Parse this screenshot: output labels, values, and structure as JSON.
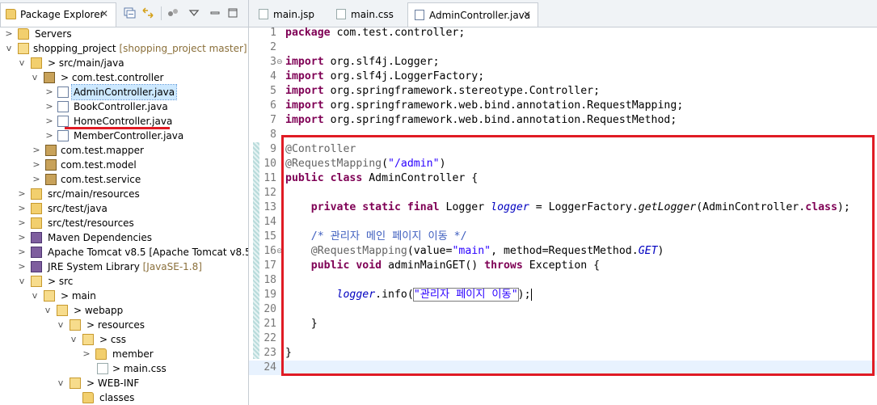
{
  "package_explorer": {
    "tab_label": "Package Explorer",
    "close_glyph": "✕",
    "toolbar_icons": [
      "collapse-all-icon",
      "link-with-editor-icon",
      "filter-icon",
      "view-menu-icon",
      "minimize-icon",
      "maximize-icon"
    ],
    "tree": [
      {
        "label": "Servers",
        "twisty": ">",
        "icon": "folder-icon"
      },
      {
        "label": "shopping_project",
        "suffix": " [shopping_project master]",
        "twisty": "v",
        "icon": "project-icon"
      },
      {
        "label": "> src/main/java",
        "twisty": "v",
        "icon": "source-folder-icon"
      },
      {
        "label": "> com.test.controller",
        "twisty": "v",
        "icon": "package-icon"
      },
      {
        "label": "AdminController.java",
        "twisty": ">",
        "icon": "java-file-icon"
      },
      {
        "label": "BookController.java",
        "twisty": ">",
        "icon": "java-file-icon"
      },
      {
        "label": "HomeController.java",
        "twisty": ">",
        "icon": "java-file-icon"
      },
      {
        "label": "MemberController.java",
        "twisty": ">",
        "icon": "java-file-icon"
      },
      {
        "label": "com.test.mapper",
        "twisty": ">",
        "icon": "package-icon"
      },
      {
        "label": "com.test.model",
        "twisty": ">",
        "icon": "package-icon"
      },
      {
        "label": "com.test.service",
        "twisty": ">",
        "icon": "package-icon"
      },
      {
        "label": "src/main/resources",
        "twisty": ">",
        "icon": "source-folder-icon"
      },
      {
        "label": "src/test/java",
        "twisty": ">",
        "icon": "source-folder-icon"
      },
      {
        "label": "src/test/resources",
        "twisty": ">",
        "icon": "source-folder-icon"
      },
      {
        "label": "Maven Dependencies",
        "twisty": ">",
        "icon": "library-icon"
      },
      {
        "label": "Apache Tomcat v8.5 [Apache Tomcat v8.5]",
        "twisty": ">",
        "icon": "library-icon"
      },
      {
        "label": "JRE System Library",
        "suffix": " [JavaSE-1.8]",
        "twisty": ">",
        "icon": "library-icon"
      },
      {
        "label": "> src",
        "twisty": "v",
        "icon": "folder-icon"
      },
      {
        "label": "> main",
        "twisty": "v",
        "icon": "folder-icon"
      },
      {
        "label": "> webapp",
        "twisty": "v",
        "icon": "folder-icon"
      },
      {
        "label": "> resources",
        "twisty": "v",
        "icon": "folder-icon"
      },
      {
        "label": "> css",
        "twisty": "v",
        "icon": "folder-icon"
      },
      {
        "label": "member",
        "twisty": ">",
        "icon": "folder-icon"
      },
      {
        "label": "> main.css",
        "twisty": "",
        "icon": "css-file-icon"
      },
      {
        "label": "> WEB-INF",
        "twisty": "v",
        "icon": "folder-icon"
      },
      {
        "label": "classes",
        "twisty": "",
        "icon": "folder-icon"
      }
    ]
  },
  "editor": {
    "tabs": [
      {
        "label": "main.jsp",
        "active": false
      },
      {
        "label": "main.css",
        "active": false
      },
      {
        "label": "AdminController.java",
        "active": true
      }
    ],
    "close_glyph": "✕",
    "line_numbers": [
      "1",
      "2",
      "3",
      "4",
      "5",
      "6",
      "7",
      "8",
      "9",
      "10",
      "11",
      "12",
      "13",
      "14",
      "15",
      "16",
      "17",
      "18",
      "19",
      "20",
      "21",
      "22",
      "23",
      "24"
    ],
    "code": {
      "l1": {
        "kw": "package",
        "rest": " com.test.controller;"
      },
      "l3": {
        "kw": "import",
        "rest": " org.slf4j.Logger;"
      },
      "l4": {
        "kw": "import",
        "rest": " org.slf4j.LoggerFactory;"
      },
      "l5": {
        "kw": "import",
        "rest": " org.springframework.stereotype.Controller;"
      },
      "l6": {
        "kw": "import",
        "rest": " org.springframework.web.bind.annotation.RequestMapping;"
      },
      "l7": {
        "kw": "import",
        "rest": " org.springframework.web.bind.annotation.RequestMethod;"
      },
      "l9": {
        "an": "@Controller"
      },
      "l10": {
        "an": "@RequestMapping",
        "p1": "(",
        "str": "\"/admin\"",
        "p2": ")"
      },
      "l11": {
        "kw1": "public",
        "kw2": "class",
        "rest": " AdminController {"
      },
      "l13": {
        "kw1": "private",
        "kw2": "static",
        "kw3": "final",
        "t1": " Logger ",
        "field": "logger",
        "t2": " = LoggerFactory.",
        "m": "getLogger",
        "t3": "(AdminController.",
        "kw4": "class",
        "t4": ");"
      },
      "l15": {
        "cm": "/* 관리자 메인 페이지 이동 */"
      },
      "l16": {
        "an": "@RequestMapping",
        "t1": "(value=",
        "str": "\"main\"",
        "t2": ", method=RequestMethod.",
        "fi": "GET",
        "t3": ")"
      },
      "l17": {
        "kw1": "public",
        "kw2": "void",
        "t1": " adminMainGET() ",
        "kw3": "throws",
        "t2": " Exception {"
      },
      "l19": {
        "field": "logger",
        "t1": ".info(",
        "str": "\"관리자 페이지 이동\"",
        "t2": ");"
      },
      "l21": {
        "t": "}"
      },
      "l23": {
        "t": "}"
      }
    }
  },
  "colors": {
    "keyword": "#7f0055",
    "annotation": "#646464",
    "string": "#2a00ff",
    "field": "#0000c0",
    "comment": "#3f5fbf",
    "highlight_box": "#e01b24"
  }
}
